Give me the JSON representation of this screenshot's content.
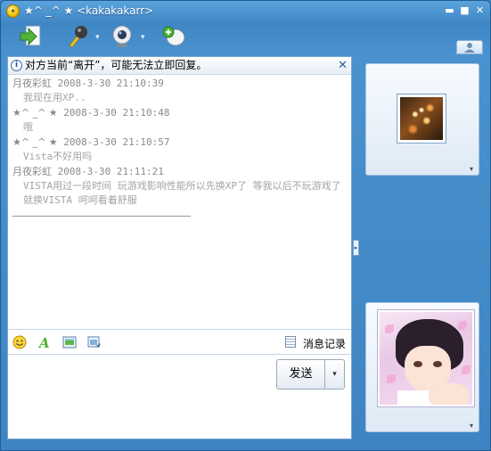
{
  "window": {
    "title": "★^ _^ ★ <kakakakarr>",
    "controls": {
      "minimize": "▬",
      "maximize": "■",
      "close": "✕"
    }
  },
  "toolbar": {
    "icons": [
      "transfer-file-icon",
      "microphone-icon",
      "webcam-icon",
      "add-contact-icon"
    ]
  },
  "notice": {
    "text": "对方当前“离开”，可能无法立即回复。",
    "close": "✕"
  },
  "messages": [
    {
      "sender": "月夜彩虹",
      "time": "2008-3-30 21:10:39",
      "text": "我现在用XP.."
    },
    {
      "sender": "★^ _^ ★",
      "time": "2008-3-30 21:10:48",
      "text": "哦"
    },
    {
      "sender": "★^ _^ ★",
      "time": "2008-3-30 21:10:57",
      "text": "Vista不好用吗"
    },
    {
      "sender": "月夜彩虹",
      "time": "2008-3-30 21:11:21",
      "text": "VISTA用过一段时间 玩游戏影响性能所以先换XP了 等我以后不玩游戏了就换VISTA 呵呵看着舒服"
    }
  ],
  "input_toolbar": {
    "history_label": "消息记录"
  },
  "send": {
    "label": "发送",
    "options": "▾"
  },
  "splitter": "▸",
  "side": {
    "chevron": "▾"
  },
  "colors": {
    "frame": "#3f86c4",
    "panel_border": "#7aa7d4",
    "message_text": "#a3a3a3"
  }
}
